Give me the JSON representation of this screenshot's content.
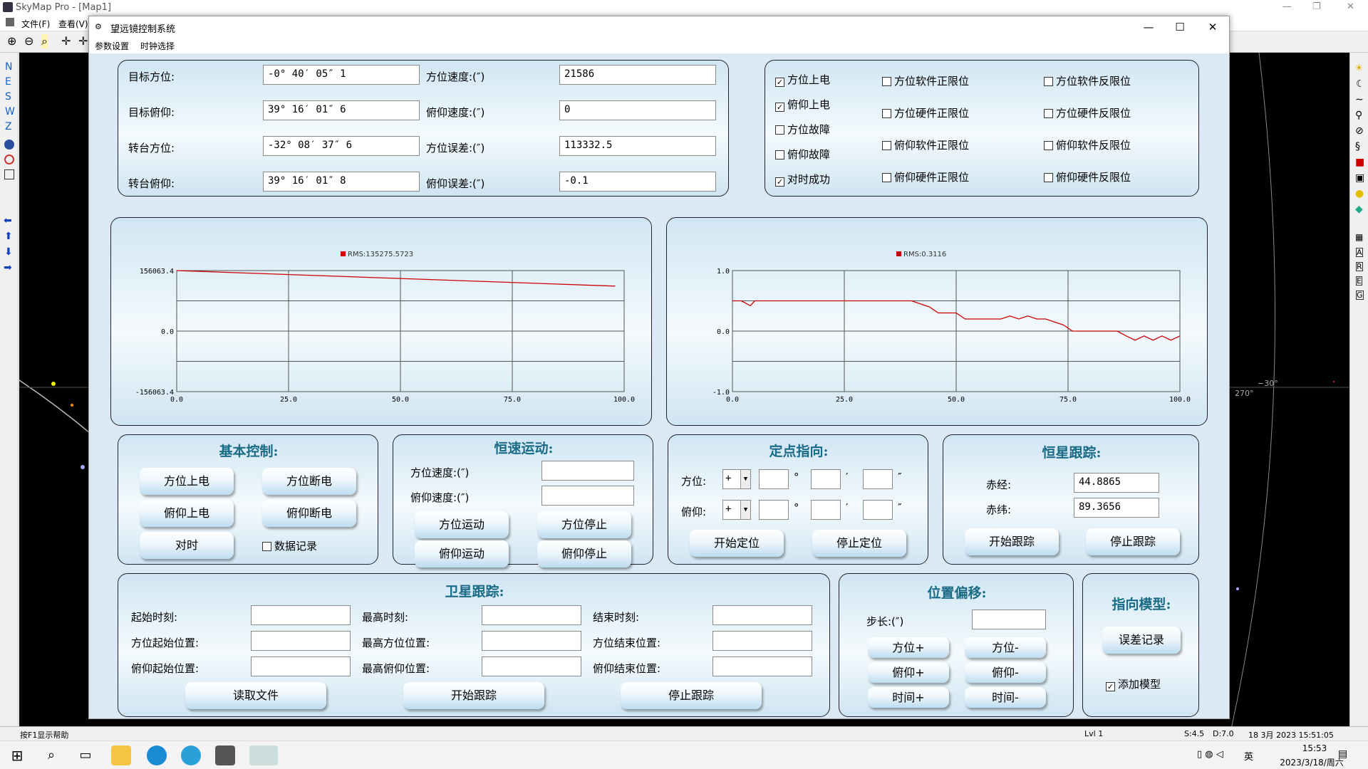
{
  "skymap": {
    "title": "SkyMap Pro - [Map1]",
    "menu": [
      "文件(F)",
      "查看(V)"
    ],
    "left_letters": [
      "N",
      "E",
      "S",
      "W",
      "Z"
    ],
    "status_help": "按F1显示帮助",
    "status_lvl": "Lvl 1",
    "status_s": "S:4.5",
    "status_d": "D:7.0",
    "status_date": "18 3月 2023 15:51:05",
    "sky_label_270": "270°",
    "sky_label_30": "−30°"
  },
  "taskbar": {
    "time": "15:53",
    "date": "2023/3/18/周六",
    "ime": "英"
  },
  "dialog": {
    "title": "望远镜控制系统",
    "menu": [
      "参数设置",
      "时钟选择"
    ],
    "status": {
      "rows": [
        {
          "l1": "目标方位:",
          "v1": "-0° 40′ 05″ 1",
          "l2": "方位速度:(″)",
          "v2": "21586"
        },
        {
          "l1": "目标俯仰:",
          "v1": "39° 16′ 01″ 6",
          "l2": "俯仰速度:(″)",
          "v2": "0"
        },
        {
          "l1": "转台方位:",
          "v1": "-32° 08′ 37″ 6",
          "l2": "方位误差:(″)",
          "v2": "113332.5"
        },
        {
          "l1": "转台俯仰:",
          "v1": "39° 16′ 01″ 8",
          "l2": "俯仰误差:(″)",
          "v2": "-0.1"
        }
      ]
    },
    "flags": [
      {
        "label": "方位上电",
        "checked": true
      },
      {
        "label": "俯仰上电",
        "checked": true
      },
      {
        "label": "方位故障",
        "checked": false
      },
      {
        "label": "俯仰故障",
        "checked": false
      },
      {
        "label": "对时成功",
        "checked": true
      },
      {
        "label": "方位软件正限位",
        "checked": false
      },
      {
        "label": "方位硬件正限位",
        "checked": false
      },
      {
        "label": "俯仰软件正限位",
        "checked": false
      },
      {
        "label": "俯仰硬件正限位",
        "checked": false
      },
      {
        "label": "方位软件反限位",
        "checked": false
      },
      {
        "label": "方位硬件反限位",
        "checked": false
      },
      {
        "label": "俯仰软件反限位",
        "checked": false
      },
      {
        "label": "俯仰硬件反限位",
        "checked": false
      }
    ],
    "basic": {
      "title": "基本控制:",
      "btns": [
        "方位上电",
        "方位断电",
        "俯仰上电",
        "俯仰断电",
        "对时"
      ],
      "chk": "数据记录",
      "chk_checked": false
    },
    "const": {
      "title": "恒速运动:",
      "l1": "方位速度:(″)",
      "l2": "俯仰速度:(″)",
      "v1": "",
      "v2": "",
      "btns": [
        "方位运动",
        "方位停止",
        "俯仰运动",
        "俯仰停止"
      ]
    },
    "point": {
      "title": "定点指向:",
      "az": "方位:",
      "el": "俯仰:",
      "sign": "+",
      "deg": "°",
      "min": "′",
      "sec": "″",
      "btns": [
        "开始定位",
        "停止定位"
      ]
    },
    "star": {
      "title": "恒星跟踪:",
      "ra_l": "赤经:",
      "ra": "44.8865",
      "dec_l": "赤纬:",
      "dec": "89.3656",
      "btns": [
        "开始跟踪",
        "停止跟踪"
      ]
    },
    "sat": {
      "title": "卫星跟踪:",
      "labels": [
        "起始时刻:",
        "最高时刻:",
        "结束时刻:",
        "方位起始位置:",
        "最高方位位置:",
        "方位结束位置:",
        "俯仰起始位置:",
        "最高俯仰位置:",
        "俯仰结束位置:"
      ],
      "btns": [
        "读取文件",
        "开始跟踪",
        "停止跟踪"
      ]
    },
    "offset": {
      "title": "位置偏移:",
      "step": "步长:(″)",
      "btns": [
        "方位+",
        "方位-",
        "俯仰+",
        "俯仰-",
        "时间+",
        "时间-"
      ]
    },
    "model": {
      "title": "指向模型:",
      "btn": "误差记录",
      "chk": "添加模型",
      "chk_checked": true
    }
  },
  "chart_data": [
    {
      "type": "line",
      "legend": "RMS:135275.5723",
      "color": "#cc0000",
      "x": [
        0,
        100
      ],
      "series": [
        {
          "name": "RMS:135275.5723",
          "x": [
            0,
            98
          ],
          "y": [
            156063.4,
            116000
          ]
        }
      ],
      "xlim": [
        0,
        100
      ],
      "ylim": [
        -156063.4,
        156063.4
      ],
      "xticks": [
        "0.0",
        "25.0",
        "50.0",
        "75.0",
        "100.0"
      ],
      "yticks": [
        "156063.4",
        "0.0",
        "-156063.4"
      ]
    },
    {
      "type": "line",
      "legend": "RMS:0.3116",
      "color": "#cc0000",
      "series": [
        {
          "name": "RMS:0.3116",
          "x": [
            0,
            2,
            4,
            5,
            6,
            10,
            20,
            30,
            40,
            44,
            46,
            50,
            52,
            56,
            60,
            62,
            64,
            66,
            68,
            70,
            72,
            74,
            76,
            80,
            84,
            86,
            88,
            90,
            92,
            94,
            96,
            98,
            100
          ],
          "y": [
            0.5,
            0.5,
            0.42,
            0.5,
            0.5,
            0.5,
            0.5,
            0.5,
            0.5,
            0.4,
            0.3,
            0.3,
            0.2,
            0.2,
            0.2,
            0.25,
            0.2,
            0.25,
            0.2,
            0.2,
            0.15,
            0.1,
            0.0,
            0.0,
            0.0,
            0.0,
            -0.08,
            -0.15,
            -0.08,
            -0.15,
            -0.08,
            -0.15,
            -0.08
          ]
        }
      ],
      "xlim": [
        0,
        100
      ],
      "ylim": [
        -1,
        1
      ],
      "xticks": [
        "0.0",
        "25.0",
        "50.0",
        "75.0",
        "100.0"
      ],
      "yticks": [
        "1.0",
        "0.0",
        "-1.0"
      ]
    }
  ]
}
